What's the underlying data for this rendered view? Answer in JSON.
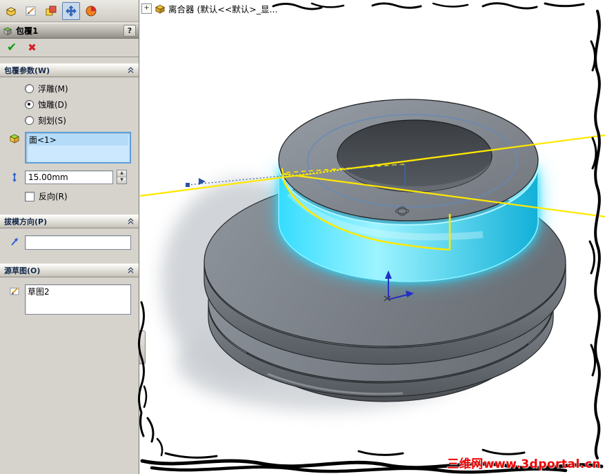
{
  "colors": {
    "panel_bg": "#d6d3cd",
    "selection_blue_fill": "#cbe8ff",
    "selection_blue_border": "#5e9fd8",
    "highlight_cyan": "#2bd9fe",
    "sketch_yellow": "#ffe800",
    "sketch_blue": "#3a66a8",
    "watermark_red": "#ee0000",
    "ok_green": "#0d9c0d",
    "cancel_red": "#d42020"
  },
  "toolbar": {
    "icons": [
      "features-tool-icon",
      "sketch-tool-icon",
      "display-tool-icon",
      "move-tool-icon",
      "render-tool-icon"
    ]
  },
  "property_manager": {
    "title": "包覆1",
    "help_label": "?",
    "ok_glyph": "✔",
    "cancel_glyph": "✖",
    "wrap_params": {
      "header": "包覆参数(W)",
      "radios": [
        {
          "label": "浮雕(M)",
          "checked": false
        },
        {
          "label": "蚀雕(D)",
          "checked": true
        },
        {
          "label": "刻划(S)",
          "checked": false
        }
      ],
      "face_value": "面<1>",
      "depth_value": "15.00mm",
      "spin_up": "▲",
      "spin_down": "▼",
      "reverse": {
        "label": "反向(R)",
        "checked": false
      }
    },
    "draft_direction": {
      "header": "拔模方向(P)",
      "value": ""
    },
    "source_sketch": {
      "header": "源草图(O)",
      "value": "草图2"
    }
  },
  "viewport": {
    "tree_label": "离合器 (默认<<默认>_显...",
    "expander_glyph": "+"
  },
  "watermark": {
    "text": "三维网www.3dportal.cn"
  }
}
